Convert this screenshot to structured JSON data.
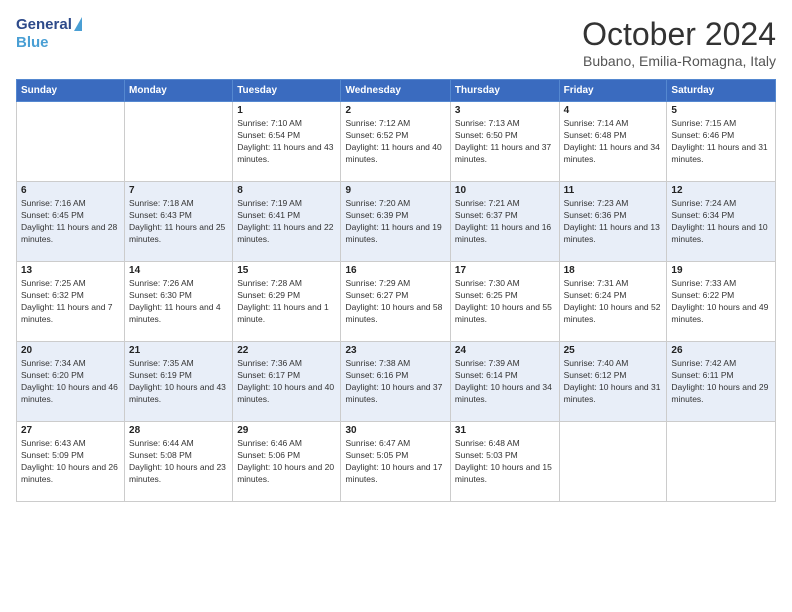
{
  "header": {
    "logo_general": "General",
    "logo_blue": "Blue",
    "month_title": "October 2024",
    "location": "Bubano, Emilia-Romagna, Italy"
  },
  "days_of_week": [
    "Sunday",
    "Monday",
    "Tuesday",
    "Wednesday",
    "Thursday",
    "Friday",
    "Saturday"
  ],
  "weeks": [
    [
      {
        "day": "",
        "sunrise": "",
        "sunset": "",
        "daylight": ""
      },
      {
        "day": "",
        "sunrise": "",
        "sunset": "",
        "daylight": ""
      },
      {
        "day": "1",
        "sunrise": "Sunrise: 7:10 AM",
        "sunset": "Sunset: 6:54 PM",
        "daylight": "Daylight: 11 hours and 43 minutes."
      },
      {
        "day": "2",
        "sunrise": "Sunrise: 7:12 AM",
        "sunset": "Sunset: 6:52 PM",
        "daylight": "Daylight: 11 hours and 40 minutes."
      },
      {
        "day": "3",
        "sunrise": "Sunrise: 7:13 AM",
        "sunset": "Sunset: 6:50 PM",
        "daylight": "Daylight: 11 hours and 37 minutes."
      },
      {
        "day": "4",
        "sunrise": "Sunrise: 7:14 AM",
        "sunset": "Sunset: 6:48 PM",
        "daylight": "Daylight: 11 hours and 34 minutes."
      },
      {
        "day": "5",
        "sunrise": "Sunrise: 7:15 AM",
        "sunset": "Sunset: 6:46 PM",
        "daylight": "Daylight: 11 hours and 31 minutes."
      }
    ],
    [
      {
        "day": "6",
        "sunrise": "Sunrise: 7:16 AM",
        "sunset": "Sunset: 6:45 PM",
        "daylight": "Daylight: 11 hours and 28 minutes."
      },
      {
        "day": "7",
        "sunrise": "Sunrise: 7:18 AM",
        "sunset": "Sunset: 6:43 PM",
        "daylight": "Daylight: 11 hours and 25 minutes."
      },
      {
        "day": "8",
        "sunrise": "Sunrise: 7:19 AM",
        "sunset": "Sunset: 6:41 PM",
        "daylight": "Daylight: 11 hours and 22 minutes."
      },
      {
        "day": "9",
        "sunrise": "Sunrise: 7:20 AM",
        "sunset": "Sunset: 6:39 PM",
        "daylight": "Daylight: 11 hours and 19 minutes."
      },
      {
        "day": "10",
        "sunrise": "Sunrise: 7:21 AM",
        "sunset": "Sunset: 6:37 PM",
        "daylight": "Daylight: 11 hours and 16 minutes."
      },
      {
        "day": "11",
        "sunrise": "Sunrise: 7:23 AM",
        "sunset": "Sunset: 6:36 PM",
        "daylight": "Daylight: 11 hours and 13 minutes."
      },
      {
        "day": "12",
        "sunrise": "Sunrise: 7:24 AM",
        "sunset": "Sunset: 6:34 PM",
        "daylight": "Daylight: 11 hours and 10 minutes."
      }
    ],
    [
      {
        "day": "13",
        "sunrise": "Sunrise: 7:25 AM",
        "sunset": "Sunset: 6:32 PM",
        "daylight": "Daylight: 11 hours and 7 minutes."
      },
      {
        "day": "14",
        "sunrise": "Sunrise: 7:26 AM",
        "sunset": "Sunset: 6:30 PM",
        "daylight": "Daylight: 11 hours and 4 minutes."
      },
      {
        "day": "15",
        "sunrise": "Sunrise: 7:28 AM",
        "sunset": "Sunset: 6:29 PM",
        "daylight": "Daylight: 11 hours and 1 minute."
      },
      {
        "day": "16",
        "sunrise": "Sunrise: 7:29 AM",
        "sunset": "Sunset: 6:27 PM",
        "daylight": "Daylight: 10 hours and 58 minutes."
      },
      {
        "day": "17",
        "sunrise": "Sunrise: 7:30 AM",
        "sunset": "Sunset: 6:25 PM",
        "daylight": "Daylight: 10 hours and 55 minutes."
      },
      {
        "day": "18",
        "sunrise": "Sunrise: 7:31 AM",
        "sunset": "Sunset: 6:24 PM",
        "daylight": "Daylight: 10 hours and 52 minutes."
      },
      {
        "day": "19",
        "sunrise": "Sunrise: 7:33 AM",
        "sunset": "Sunset: 6:22 PM",
        "daylight": "Daylight: 10 hours and 49 minutes."
      }
    ],
    [
      {
        "day": "20",
        "sunrise": "Sunrise: 7:34 AM",
        "sunset": "Sunset: 6:20 PM",
        "daylight": "Daylight: 10 hours and 46 minutes."
      },
      {
        "day": "21",
        "sunrise": "Sunrise: 7:35 AM",
        "sunset": "Sunset: 6:19 PM",
        "daylight": "Daylight: 10 hours and 43 minutes."
      },
      {
        "day": "22",
        "sunrise": "Sunrise: 7:36 AM",
        "sunset": "Sunset: 6:17 PM",
        "daylight": "Daylight: 10 hours and 40 minutes."
      },
      {
        "day": "23",
        "sunrise": "Sunrise: 7:38 AM",
        "sunset": "Sunset: 6:16 PM",
        "daylight": "Daylight: 10 hours and 37 minutes."
      },
      {
        "day": "24",
        "sunrise": "Sunrise: 7:39 AM",
        "sunset": "Sunset: 6:14 PM",
        "daylight": "Daylight: 10 hours and 34 minutes."
      },
      {
        "day": "25",
        "sunrise": "Sunrise: 7:40 AM",
        "sunset": "Sunset: 6:12 PM",
        "daylight": "Daylight: 10 hours and 31 minutes."
      },
      {
        "day": "26",
        "sunrise": "Sunrise: 7:42 AM",
        "sunset": "Sunset: 6:11 PM",
        "daylight": "Daylight: 10 hours and 29 minutes."
      }
    ],
    [
      {
        "day": "27",
        "sunrise": "Sunrise: 6:43 AM",
        "sunset": "Sunset: 5:09 PM",
        "daylight": "Daylight: 10 hours and 26 minutes."
      },
      {
        "day": "28",
        "sunrise": "Sunrise: 6:44 AM",
        "sunset": "Sunset: 5:08 PM",
        "daylight": "Daylight: 10 hours and 23 minutes."
      },
      {
        "day": "29",
        "sunrise": "Sunrise: 6:46 AM",
        "sunset": "Sunset: 5:06 PM",
        "daylight": "Daylight: 10 hours and 20 minutes."
      },
      {
        "day": "30",
        "sunrise": "Sunrise: 6:47 AM",
        "sunset": "Sunset: 5:05 PM",
        "daylight": "Daylight: 10 hours and 17 minutes."
      },
      {
        "day": "31",
        "sunrise": "Sunrise: 6:48 AM",
        "sunset": "Sunset: 5:03 PM",
        "daylight": "Daylight: 10 hours and 15 minutes."
      },
      {
        "day": "",
        "sunrise": "",
        "sunset": "",
        "daylight": ""
      },
      {
        "day": "",
        "sunrise": "",
        "sunset": "",
        "daylight": ""
      }
    ]
  ]
}
